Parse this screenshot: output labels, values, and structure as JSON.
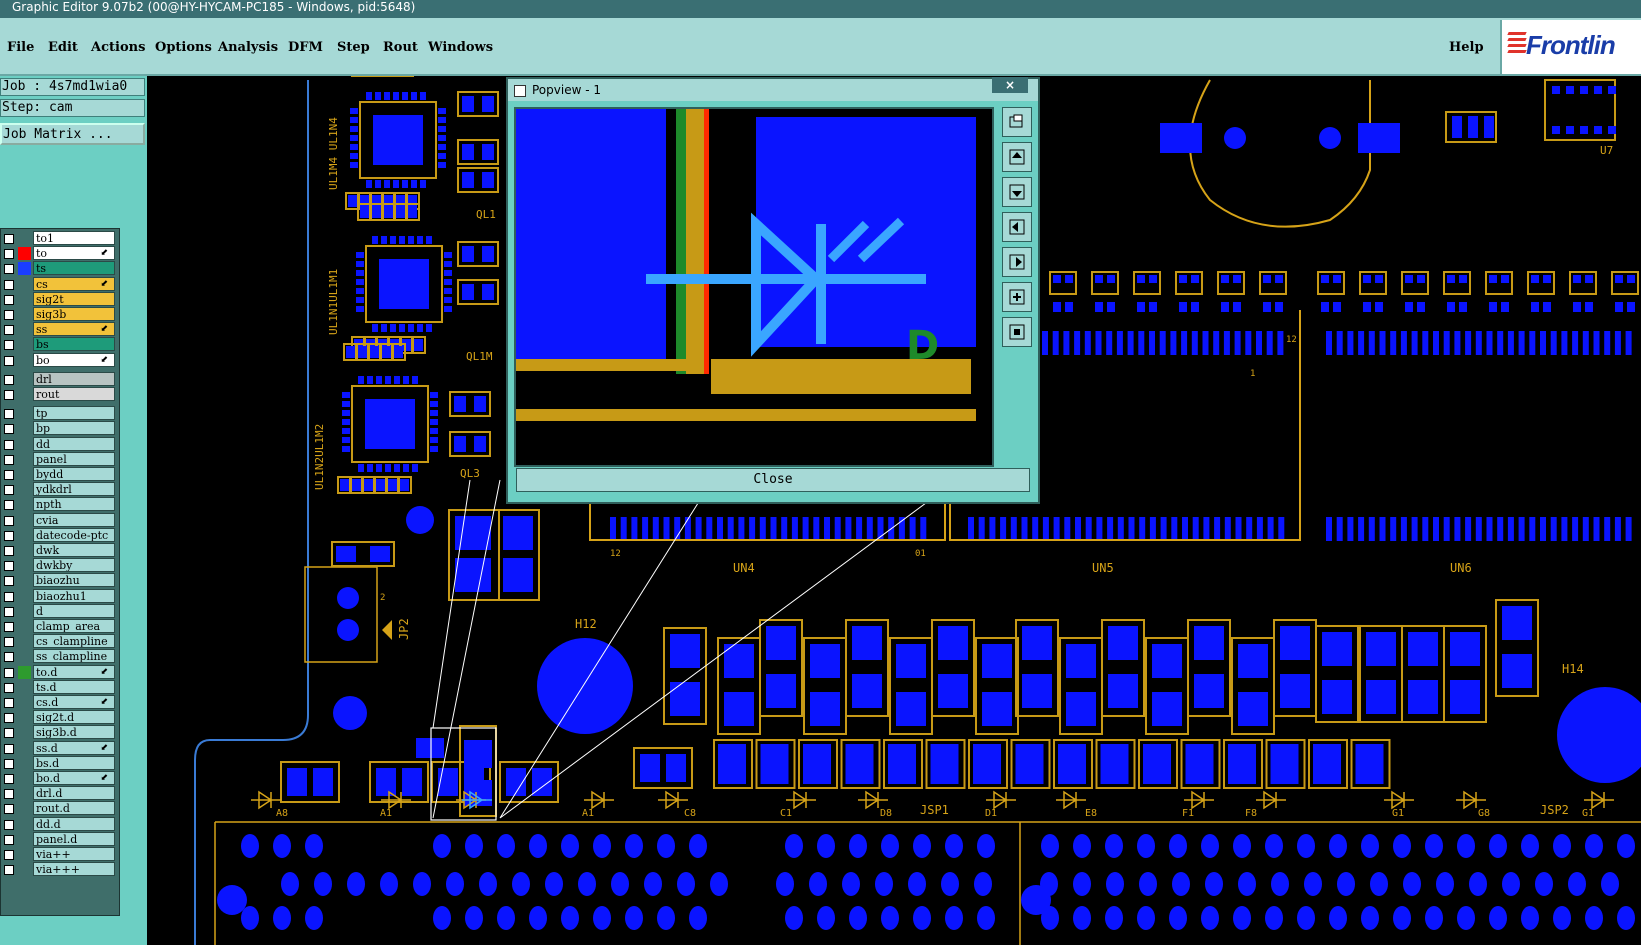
{
  "window": {
    "title": "Graphic Editor 9.07b2 (00@HY-HYCAM-PC185 - Windows, pid:5648)"
  },
  "menu": {
    "items": [
      "File",
      "Edit",
      "Actions",
      "Options",
      "Analysis",
      "DFM",
      "Step",
      "Rout",
      "Windows"
    ],
    "help": "Help",
    "logo": "Frontlin"
  },
  "job": {
    "job_line": "Job : 4s7md1wia0",
    "step_line": "Step: cam",
    "matrix_button": "Job Matrix ..."
  },
  "layers": [
    {
      "name": "to1",
      "color": "#ffffff",
      "swatch": ""
    },
    {
      "name": "to",
      "color": "#ffffff",
      "swatch": "#ff0000",
      "arrow": true
    },
    {
      "name": "ts",
      "color": "#1e9b7a",
      "swatch": "#1a3dff"
    },
    {
      "name": "cs",
      "color": "#f2c23a",
      "swatch": "",
      "arrow": true
    },
    {
      "name": "sig2t",
      "color": "#f2c23a",
      "swatch": ""
    },
    {
      "name": "sig3b",
      "color": "#f2c23a",
      "swatch": ""
    },
    {
      "name": "ss",
      "color": "#f2c23a",
      "swatch": "",
      "arrow": true
    },
    {
      "name": "bs",
      "color": "#1e9b7a",
      "swatch": ""
    },
    {
      "name": "bo",
      "color": "#ffffff",
      "swatch": "",
      "arrow": true
    },
    {
      "name": "drl",
      "color": "#b8c4c2",
      "swatch": ""
    },
    {
      "name": "rout",
      "color": "#d9d9d9",
      "swatch": ""
    },
    {
      "name": "tp",
      "color": "#a6d9d6",
      "swatch": ""
    },
    {
      "name": "bp",
      "color": "#a6d9d6",
      "swatch": ""
    },
    {
      "name": "dd",
      "color": "#a6d9d6",
      "swatch": ""
    },
    {
      "name": "panel",
      "color": "#a6d9d6",
      "swatch": ""
    },
    {
      "name": "bydd",
      "color": "#a6d9d6",
      "swatch": ""
    },
    {
      "name": "ydkdrl",
      "color": "#a6d9d6",
      "swatch": ""
    },
    {
      "name": "npth",
      "color": "#a6d9d6",
      "swatch": ""
    },
    {
      "name": "cvia",
      "color": "#a6d9d6",
      "swatch": ""
    },
    {
      "name": "datecode-ptc",
      "color": "#a6d9d6",
      "swatch": ""
    },
    {
      "name": "dwk",
      "color": "#a6d9d6",
      "swatch": ""
    },
    {
      "name": "dwkby",
      "color": "#a6d9d6",
      "swatch": ""
    },
    {
      "name": "biaozhu",
      "color": "#a6d9d6",
      "swatch": ""
    },
    {
      "name": "biaozhu1",
      "color": "#a6d9d6",
      "swatch": ""
    },
    {
      "name": "d",
      "color": "#a6d9d6",
      "swatch": ""
    },
    {
      "name": "clamp_area",
      "color": "#a6d9d6",
      "swatch": ""
    },
    {
      "name": "cs_clampline",
      "color": "#a6d9d6",
      "swatch": ""
    },
    {
      "name": "ss_clampline",
      "color": "#a6d9d6",
      "swatch": ""
    },
    {
      "name": "to.d",
      "color": "#a6d9d6",
      "swatch": "#2e9b2e",
      "arrow": true
    },
    {
      "name": "ts.d",
      "color": "#a6d9d6",
      "swatch": ""
    },
    {
      "name": "cs.d",
      "color": "#a6d9d6",
      "swatch": "",
      "arrow": true
    },
    {
      "name": "sig2t.d",
      "color": "#a6d9d6",
      "swatch": ""
    },
    {
      "name": "sig3b.d",
      "color": "#a6d9d6",
      "swatch": ""
    },
    {
      "name": "ss.d",
      "color": "#a6d9d6",
      "swatch": "",
      "arrow": true
    },
    {
      "name": "bs.d",
      "color": "#a6d9d6",
      "swatch": ""
    },
    {
      "name": "bo.d",
      "color": "#a6d9d6",
      "swatch": "",
      "arrow": true
    },
    {
      "name": "drl.d",
      "color": "#a6d9d6",
      "swatch": ""
    },
    {
      "name": "rout.d",
      "color": "#a6d9d6",
      "swatch": ""
    },
    {
      "name": "dd.d",
      "color": "#a6d9d6",
      "swatch": ""
    },
    {
      "name": "panel.d",
      "color": "#a6d9d6",
      "swatch": ""
    },
    {
      "name": "via++",
      "color": "#a6d9d6",
      "swatch": ""
    },
    {
      "name": "via+++",
      "color": "#a6d9d6",
      "swatch": ""
    }
  ],
  "popview": {
    "title": "Popview - 1",
    "close_x": "×",
    "close_button": "Close",
    "tool_icons": [
      "zoom-fit-icon",
      "pan-up-icon",
      "pan-down-icon",
      "pan-left-icon",
      "pan-right-icon",
      "zoom-out-icon",
      "zoom-in-icon"
    ]
  },
  "pcb": {
    "designators": [
      "UN4",
      "UN5",
      "UN6",
      "H12",
      "H14",
      "JP2",
      "JSP1",
      "JSP2",
      "U7",
      "UL1M4 UL1N4",
      "UL1N1UL1M1",
      "UL1N2UL1M2",
      "QL1",
      "QL1M",
      "QL3"
    ],
    "pin_labels": [
      "A8",
      "A1",
      "B1",
      "C8",
      "C1",
      "D8",
      "D1",
      "E8",
      "F1",
      "F8",
      "G1",
      "G8",
      "12",
      "01",
      "1",
      "2"
    ]
  },
  "colors": {
    "pad": "#0a14ff",
    "outline": "#c79a16",
    "silk": "#d6a318",
    "panel": "#6ccfc3",
    "header": "#a6d9d6"
  }
}
